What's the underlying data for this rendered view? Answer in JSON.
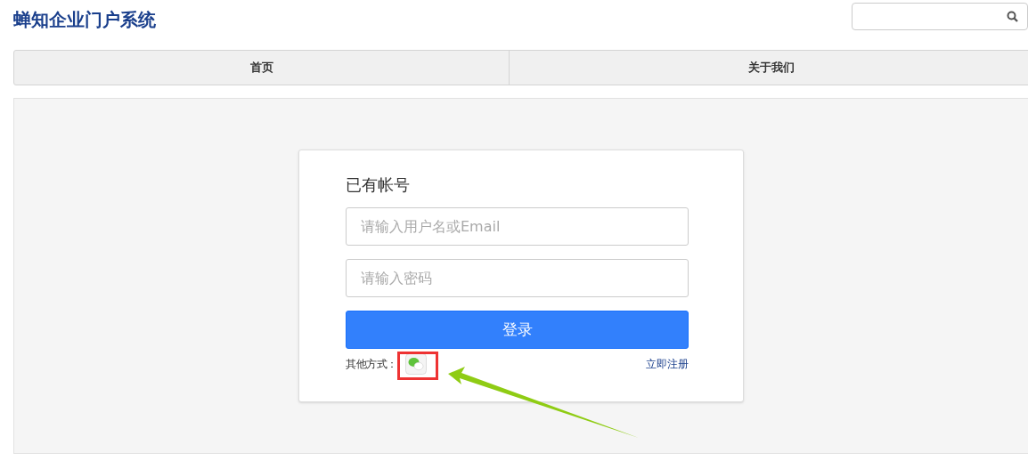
{
  "header": {
    "title": "蝉知企业门户系统"
  },
  "nav": {
    "tabs": [
      {
        "label": "首页",
        "selected": false
      },
      {
        "label": "关于我们",
        "selected": false
      }
    ]
  },
  "login": {
    "title": "已有帐号",
    "username": {
      "placeholder": "请输入用户名或Email"
    },
    "password": {
      "placeholder": "请输入密码"
    },
    "submit": "登录",
    "other_label": "其他方式：",
    "register_link": "立即注册"
  }
}
